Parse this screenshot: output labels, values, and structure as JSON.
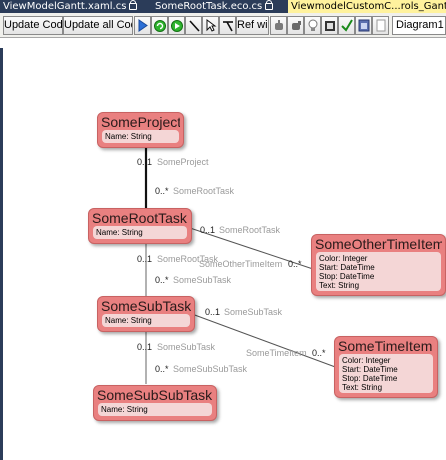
{
  "tabs": [
    {
      "label": "ViewModelGantt.xaml.cs",
      "locked": true
    },
    {
      "label": "SomeRootTask.eco.cs",
      "locked": true
    },
    {
      "label": "ViewmodelCustomC...rols_Gantt.e",
      "locked": false,
      "active": true
    }
  ],
  "toolbar": {
    "update_code": "Update Code",
    "update_all_code": "Update all Code",
    "ref_win": "Ref win",
    "diagram_selected": "Diagram1",
    "icons": [
      "play-icon",
      "refresh-green-icon",
      "arrow-green-icon",
      "line-tool-icon",
      "pointer-tool-icon",
      "tee-tool-icon",
      "hand-tool-icon",
      "hand-grab-icon",
      "bulb-icon",
      "film-icon",
      "checkmark-icon",
      "window-icon",
      "page-icon"
    ]
  },
  "colors": {
    "class_fill": "#e98080",
    "attr_fill": "#f4d6d6",
    "tab_bg": "#2b3c59",
    "tab_active": "#fff29d"
  },
  "classes": {
    "project": {
      "name": "SomeProject",
      "attrs": [
        "Name: String"
      ]
    },
    "root_task": {
      "name": "SomeRootTask",
      "attrs": [
        "Name: String"
      ]
    },
    "sub_task": {
      "name": "SomeSubTask",
      "attrs": [
        "Name: String"
      ]
    },
    "subsub_task": {
      "name": "SomeSubSubTask",
      "attrs": [
        "Name: String"
      ]
    },
    "other_time_item": {
      "name": "SomeOtherTimeItem",
      "attrs": [
        "Color: Integer",
        "Start: DateTime",
        "Stop: DateTime",
        "Text: String"
      ]
    },
    "time_item": {
      "name": "SomeTimeItem",
      "attrs": [
        "Color: Integer",
        "Start: DateTime",
        "Stop: DateTime",
        "Text: String"
      ]
    }
  },
  "associations": {
    "project_root": {
      "end1_mult": "0..1",
      "end1_role": "SomeProject",
      "end2_mult": "0..*",
      "end2_role": "SomeRootTask"
    },
    "root_other": {
      "end1_mult": "0..1",
      "end1_role": "SomeRootTask",
      "end2_mult": "0..*",
      "end2_role": "SomeOtherTimeItem"
    },
    "root_sub": {
      "end1_mult": "0..1",
      "end1_role": "SomeRootTask",
      "end2_mult": "0..*",
      "end2_role": "SomeSubTask"
    },
    "sub_time": {
      "end1_mult": "0..1",
      "end1_role": "SomeSubTask",
      "end2_mult": "0..*",
      "end2_role": "SomeTimeItem"
    },
    "sub_subsub": {
      "end1_mult": "0..1",
      "end1_role": "SomeSubTask",
      "end2_mult": "0..*",
      "end2_role": "SomeSubSubTask"
    }
  }
}
